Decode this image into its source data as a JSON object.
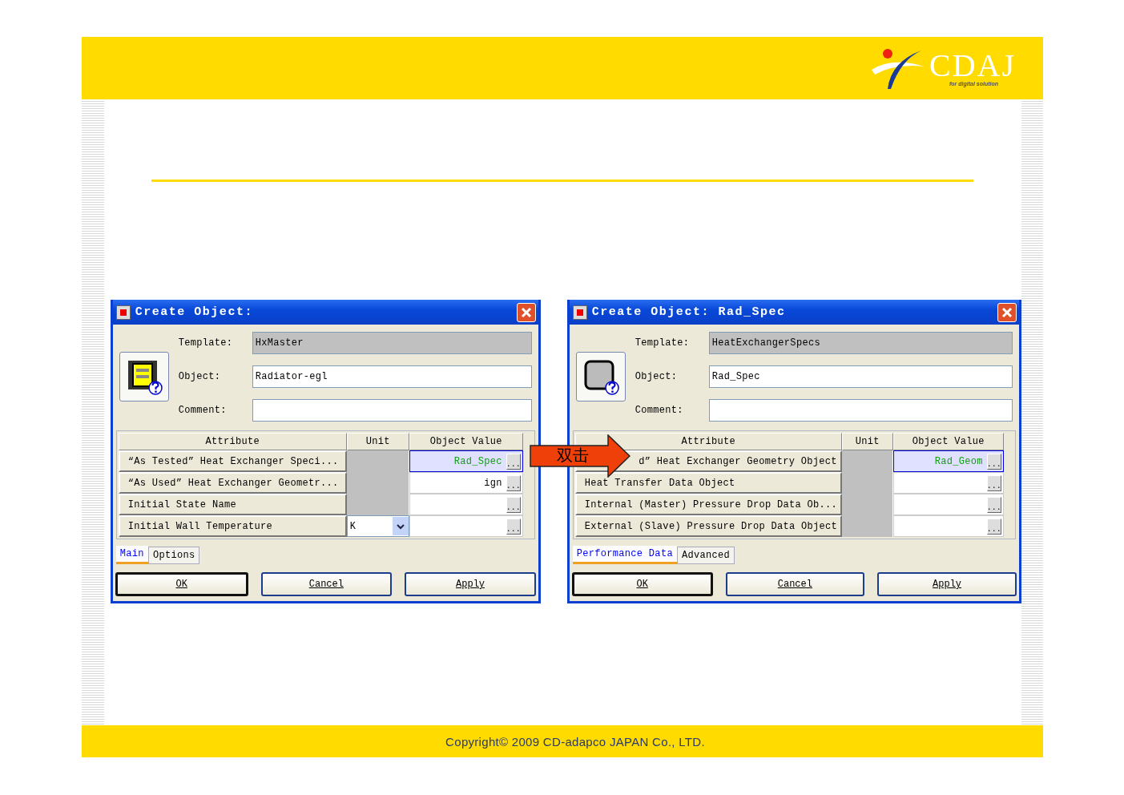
{
  "header": {
    "logo_text": "CDAJ",
    "logo_tagline": "for digital solution"
  },
  "annotation": {
    "label": "双击"
  },
  "dialogs": [
    {
      "title": "Create Object:",
      "fields": [
        {
          "label": "Template:",
          "value": "HxMaster",
          "readonly": true
        },
        {
          "label": "Object:",
          "value": "Radiator-egl",
          "readonly": false
        },
        {
          "label": "Comment:",
          "readonly": false
        }
      ],
      "columns": [
        "Attribute",
        "Unit",
        "Object Value"
      ],
      "rows": [
        {
          "attribute": "“As Tested” Heat Exchanger Speci...",
          "value": "Rad_Spec",
          "selected": true,
          "button": "..."
        },
        {
          "attribute": "“As Used” Heat Exchanger Geometr...",
          "value": "ign",
          "selected": false,
          "button": "..."
        },
        {
          "attribute": "Initial State Name",
          "selected": false,
          "button": "..."
        },
        {
          "attribute": "Initial Wall Temperature",
          "unit": "K",
          "selected": false,
          "button": "..."
        }
      ],
      "tabs": [
        {
          "label": "Main",
          "selected": true
        },
        {
          "label": "Options",
          "selected": false
        }
      ],
      "buttons": [
        {
          "label": "OK",
          "default": true
        },
        {
          "label": "Cancel",
          "default": false
        },
        {
          "label": "Apply",
          "default": false
        }
      ]
    },
    {
      "title": "Create Object: Rad_Spec",
      "fields": [
        {
          "label": "Template:",
          "value": "HeatExchangerSpecs",
          "readonly": true
        },
        {
          "label": "Object:",
          "value": "Rad_Spec",
          "readonly": false
        },
        {
          "label": "Comment:",
          "readonly": false
        }
      ],
      "columns": [
        "Attribute",
        "Unit",
        "Object Value"
      ],
      "rows": [
        {
          "attribute": "d” Heat Exchanger Geometry Object",
          "kind": "partly_hidden",
          "value": "Rad_Geom",
          "selected": true,
          "button": "..."
        },
        {
          "attribute": "Heat Transfer Data Object",
          "selected": false,
          "button": "..."
        },
        {
          "attribute": "Internal (Master) Pressure Drop Data Ob...",
          "selected": false,
          "button": "..."
        },
        {
          "attribute": "External (Slave) Pressure Drop Data Object",
          "selected": false,
          "button": "..."
        }
      ],
      "tabs": [
        {
          "label": "Performance Data",
          "selected": true
        },
        {
          "label": "Advanced",
          "selected": false
        }
      ],
      "buttons": [
        {
          "label": "OK",
          "default": true
        },
        {
          "label": "Cancel",
          "default": false
        },
        {
          "label": "Apply",
          "default": false
        }
      ]
    }
  ],
  "footer": {
    "copyright": "Copyright© 2009 CD-adapco JAPAN Co., LTD."
  }
}
